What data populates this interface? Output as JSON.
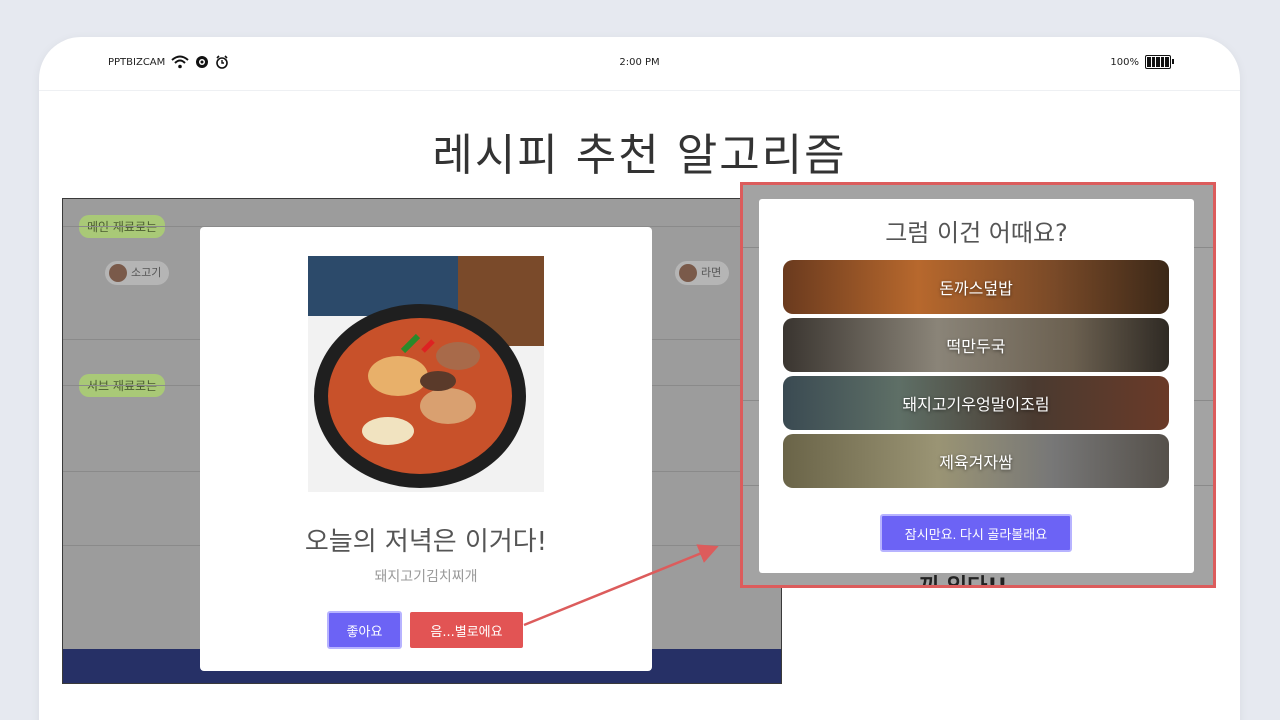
{
  "statusbar": {
    "carrier": "PPTBIZCAM",
    "time": "2:00 PM",
    "battery_pct": "100%"
  },
  "title": "레시피 추천 알고리즘",
  "background_app": {
    "section_main_label": "메인 재료로는",
    "section_sub_label": "서브 재료로는",
    "chips": [
      "소고기",
      "라면"
    ]
  },
  "dinner_modal": {
    "title": "오늘의 저녁은 이거다!",
    "recipe": "돼지고기김치찌개",
    "like_label": "좋아요",
    "dislike_label": "음...별로에요"
  },
  "suggest_modal": {
    "title": "그럼 이건 어때요?",
    "options": [
      "돈까스덮밥",
      "떡만두국",
      "돼지고기우엉말이조림",
      "제육겨자쌈"
    ],
    "retry_label": "잠시만요. 다시 골라볼래요",
    "background_text": "끼 있다!!"
  },
  "colors": {
    "accent_purple": "#6c63f5",
    "danger_red": "#e25454",
    "highlight_border": "#dc5c5c",
    "label_green": "#a9c977"
  }
}
